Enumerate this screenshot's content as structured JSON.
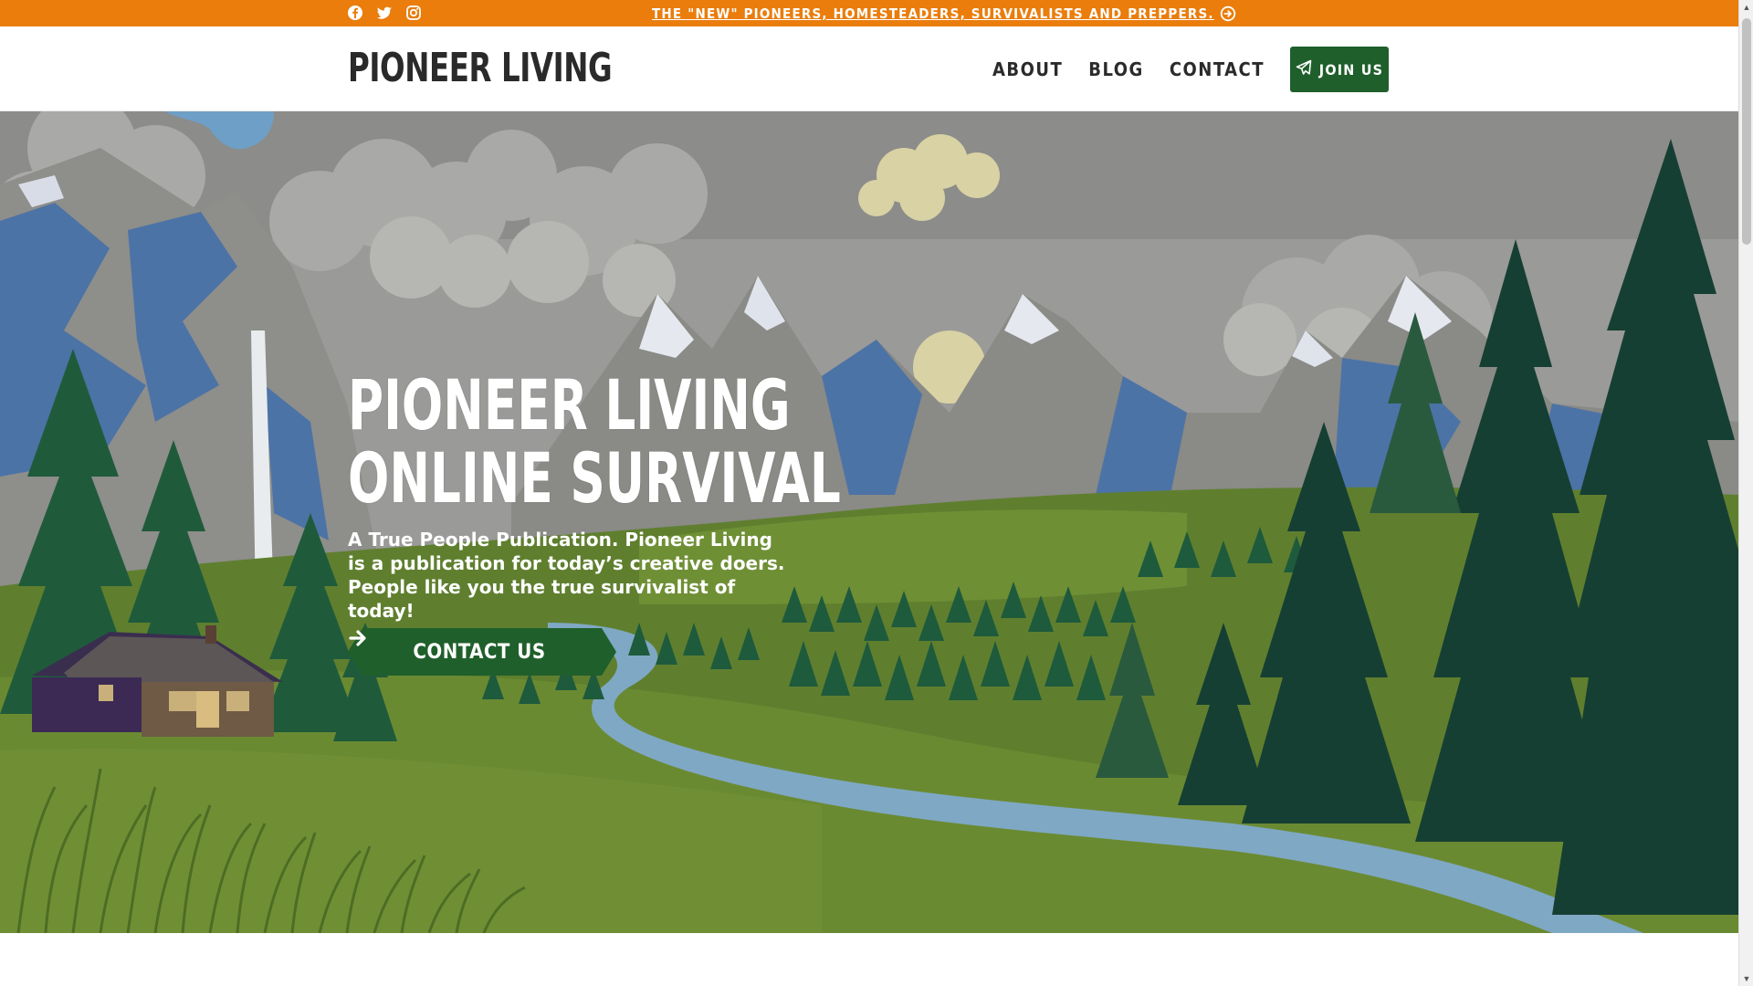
{
  "topbar": {
    "social_icons": [
      "facebook-icon",
      "twitter-icon",
      "instagram-icon"
    ],
    "announcement": "THE \"NEW\" PIONEERS, HOMESTEADERS, SURVIVALISTS AND PREPPERS.",
    "announcement_icon": "arrow-circle-right-icon",
    "background_color": "#ea7d0c"
  },
  "header": {
    "logo": "PIONEER LIVING",
    "nav": {
      "about": "ABOUT",
      "blog": "BLOG",
      "contact": "CONTACT"
    },
    "join_button": {
      "label": "JOIN US",
      "icon": "paper-plane-icon",
      "color": "#1f5f2b"
    }
  },
  "hero": {
    "title_line1": "PIONEER LIVING",
    "title_line2": "ONLINE SURVIVAL",
    "subtitle": "A True People Publication. Pioneer Living is a publication for today’s creative doers. People like you the true survivalist of today!",
    "cta": {
      "label": "CONTACT US",
      "icon": "arrow-right-icon",
      "color": "#1f5f2b"
    }
  }
}
